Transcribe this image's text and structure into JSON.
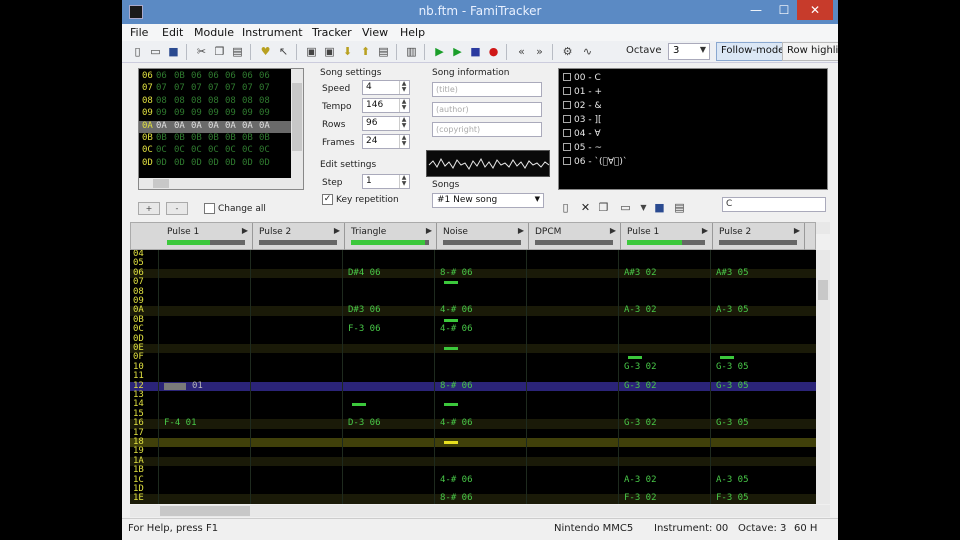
{
  "window": {
    "title": "nb.ftm - FamiTracker",
    "min": "—",
    "max": "☐",
    "close": "✕"
  },
  "menu": [
    "File",
    "Edit",
    "Module",
    "Instrument",
    "Tracker",
    "View",
    "Help"
  ],
  "toolbar": {
    "octave_label": "Octave",
    "octave_value": "3",
    "follow_mode": "Follow-mode",
    "row_highlight": "Row highlight"
  },
  "frames": {
    "rows": [
      {
        "num": "06",
        "cells": [
          "06",
          "0B",
          "06",
          "06",
          "06",
          "06",
          "06"
        ]
      },
      {
        "num": "07",
        "cells": [
          "07",
          "07",
          "07",
          "07",
          "07",
          "07",
          "07"
        ]
      },
      {
        "num": "08",
        "cells": [
          "08",
          "08",
          "08",
          "08",
          "08",
          "08",
          "08"
        ]
      },
      {
        "num": "09",
        "cells": [
          "09",
          "09",
          "09",
          "09",
          "09",
          "09",
          "09"
        ]
      },
      {
        "num": "0A",
        "cells": [
          "0A",
          "0A",
          "0A",
          "0A",
          "0A",
          "0A",
          "0A"
        ]
      },
      {
        "num": "0B",
        "cells": [
          "0B",
          "0B",
          "0B",
          "0B",
          "0B",
          "0B",
          "0B"
        ]
      },
      {
        "num": "0C",
        "cells": [
          "0C",
          "0C",
          "0C",
          "0C",
          "0C",
          "0C",
          "0C"
        ]
      },
      {
        "num": "0D",
        "cells": [
          "0D",
          "0D",
          "0D",
          "0D",
          "0D",
          "0D",
          "0D"
        ]
      }
    ],
    "selected_index": 4,
    "change_all": "Change all",
    "btn_add": "+",
    "btn_remove": "-"
  },
  "song_settings": {
    "title": "Song settings",
    "speed_label": "Speed",
    "speed": "4",
    "tempo_label": "Tempo",
    "tempo": "146",
    "rows_label": "Rows",
    "rows": "96",
    "frames_label": "Frames",
    "frames": "24"
  },
  "edit_settings": {
    "title": "Edit settings",
    "step_label": "Step",
    "step": "1",
    "key_repetition": "Key repetition"
  },
  "song_info": {
    "title": "Song information",
    "name_ph": "(title)",
    "author_ph": "(author)",
    "copyright_ph": "(copyright)"
  },
  "songs": {
    "title": "Songs",
    "selected": "#1 New song"
  },
  "instruments": [
    {
      "id": "00",
      "name": "C"
    },
    {
      "id": "01",
      "name": "+"
    },
    {
      "id": "02",
      "name": "&"
    },
    {
      "id": "03",
      "name": "]["
    },
    {
      "id": "04",
      "name": "∀"
    },
    {
      "id": "05",
      "name": "~"
    },
    {
      "id": "06",
      "name": "`(ﾟ∀ﾟ)`"
    }
  ],
  "instrument_name_field": "C",
  "channels": [
    {
      "name": "Pulse 1",
      "level": 0.55
    },
    {
      "name": "Pulse 2",
      "level": 0.0
    },
    {
      "name": "Triangle",
      "level": 0.95
    },
    {
      "name": "Noise",
      "level": 0.0
    },
    {
      "name": "DPCM",
      "level": 0.0
    },
    {
      "name": "Pulse 1",
      "level": 0.7
    },
    {
      "name": "Pulse 2",
      "level": 0.0
    }
  ],
  "rows": [
    "04",
    "05",
    "06",
    "07",
    "08",
    "09",
    "0A",
    "0B",
    "0C",
    "0D",
    "0E",
    "0F",
    "10",
    "11",
    "12",
    "13",
    "14",
    "15",
    "16",
    "17",
    "18",
    "19",
    "1A",
    "1B",
    "1C",
    "1D",
    "1E"
  ],
  "notes": [
    {
      "row": 2,
      "ch": 2,
      "text": "D#4 06"
    },
    {
      "row": 2,
      "ch": 3,
      "text": "8-# 06"
    },
    {
      "row": 2,
      "ch": 5,
      "text": "A#3 02"
    },
    {
      "row": 2,
      "ch": 6,
      "text": "A#3 05"
    },
    {
      "row": 6,
      "ch": 2,
      "text": "D#3 06"
    },
    {
      "row": 6,
      "ch": 3,
      "text": "4-# 06"
    },
    {
      "row": 6,
      "ch": 5,
      "text": "A-3 02"
    },
    {
      "row": 6,
      "ch": 6,
      "text": "A-3 05"
    },
    {
      "row": 8,
      "ch": 2,
      "text": "F-3 06"
    },
    {
      "row": 8,
      "ch": 3,
      "text": "4-# 06"
    },
    {
      "row": 12,
      "ch": 5,
      "text": "G-3 02"
    },
    {
      "row": 12,
      "ch": 6,
      "text": "G-3 05"
    },
    {
      "row": 14,
      "ch": 0,
      "text": "01",
      "cls": "cur"
    },
    {
      "row": 14,
      "ch": 3,
      "text": "8-# 06"
    },
    {
      "row": 14,
      "ch": 5,
      "text": "G-3 02"
    },
    {
      "row": 14,
      "ch": 6,
      "text": "G-3 05"
    },
    {
      "row": 18,
      "ch": 0,
      "text": "F-4 01"
    },
    {
      "row": 18,
      "ch": 2,
      "text": "D-3 06"
    },
    {
      "row": 18,
      "ch": 3,
      "text": "4-# 06"
    },
    {
      "row": 18,
      "ch": 5,
      "text": "G-3 02"
    },
    {
      "row": 18,
      "ch": 6,
      "text": "G-3 05"
    },
    {
      "row": 24,
      "ch": 3,
      "text": "4-# 06"
    },
    {
      "row": 24,
      "ch": 5,
      "text": "A-3 02"
    },
    {
      "row": 24,
      "ch": 6,
      "text": "A-3 05"
    },
    {
      "row": 26,
      "ch": 3,
      "text": "8-# 06"
    },
    {
      "row": 26,
      "ch": 5,
      "text": "F-3 02"
    },
    {
      "row": 26,
      "ch": 6,
      "text": "F-3 05"
    }
  ],
  "status": {
    "help": "For Help, press F1",
    "chip": "Nintendo MMC5",
    "instrument": "Instrument: 00",
    "octave": "Octave: 3",
    "rate": "60 H"
  }
}
